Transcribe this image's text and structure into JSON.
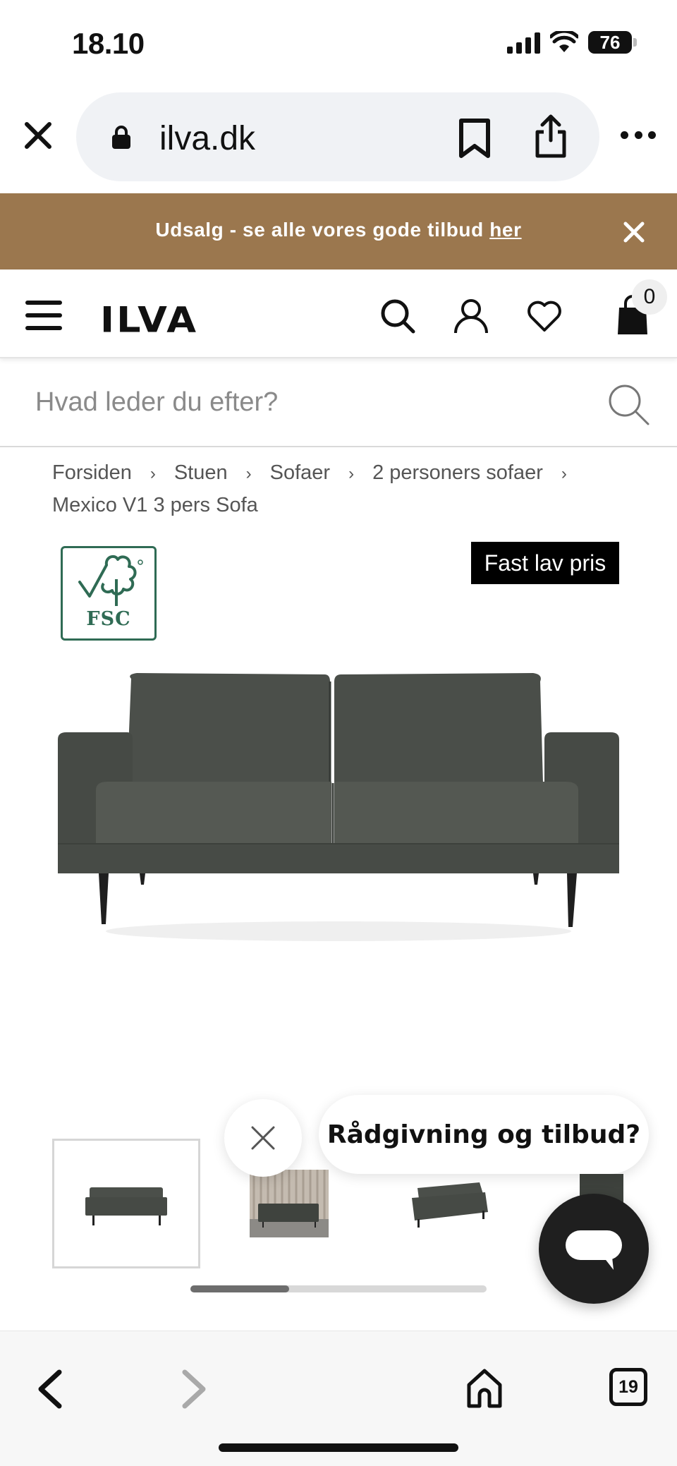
{
  "status_bar": {
    "time": "18.10",
    "battery": "76"
  },
  "browser": {
    "url": "ilva.dk"
  },
  "promo": {
    "text": "Udsalg - se alle vores gode tilbud ",
    "link": "her"
  },
  "header": {
    "logo": "ILVA",
    "cart_count": "0"
  },
  "search": {
    "placeholder": "Hvad leder du efter?",
    "value": ""
  },
  "breadcrumb": [
    "Forsiden",
    "Stuen",
    "Sofaer",
    "2 personers sofaer",
    "Mexico V1 3 pers Sofa"
  ],
  "product": {
    "certification_label": "FSC",
    "price_badge": "Fast lav pris",
    "color": "#4a4e48",
    "thumbnail_count": 4,
    "active_thumbnail": 1
  },
  "chat": {
    "prompt": "Rådgivning og tilbud?"
  },
  "toolbar": {
    "tab_count": "19"
  },
  "colors": {
    "banner": "#9b774e",
    "fsc_green": "#2f6b54",
    "badge_black": "#000000"
  }
}
